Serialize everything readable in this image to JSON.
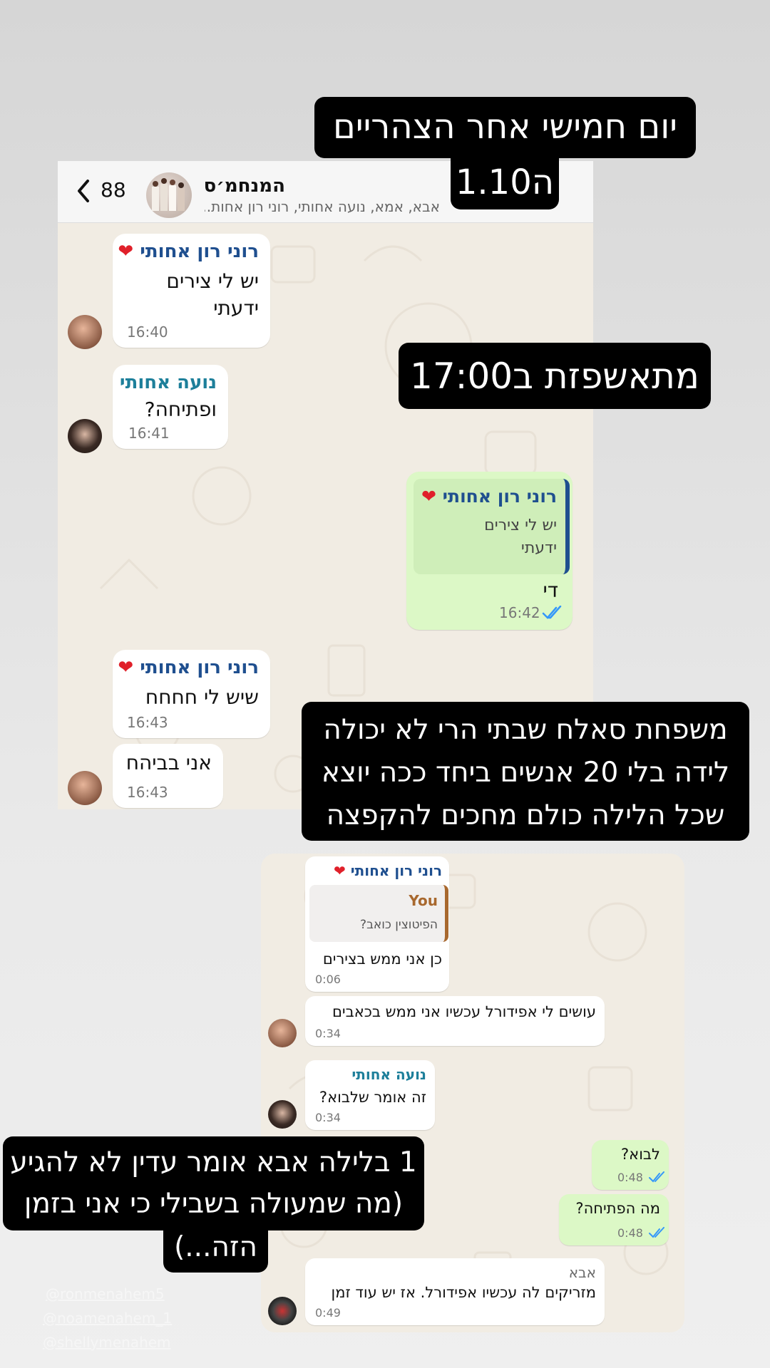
{
  "chat1": {
    "back_count": "88",
    "group_name": "המנחמ׳ס",
    "group_members": "אבא, אמא, נועה אחותי, רוני רון אחות...",
    "messages": [
      {
        "sender": "רוני רון אחותי",
        "emoji": "❤️",
        "lines": [
          "יש לי צירים",
          "ידעתי"
        ],
        "time": "16:40"
      },
      {
        "sender": "נועה אחותי",
        "lines": [
          "ופתיחה?"
        ],
        "time": "16:41"
      },
      {
        "quote_sender": "רוני רון אחותי",
        "quote_emoji": "❤️",
        "quote_lines": [
          "יש לי צירים",
          "ידעתי"
        ],
        "text": "די",
        "time": "16:42"
      },
      {
        "sender": "רוני רון אחותי",
        "emoji": "❤️",
        "lines": [
          "שיש לי חחחח"
        ],
        "time": "16:43"
      },
      {
        "text": "אני בביהח",
        "time": "16:43"
      }
    ]
  },
  "chat2": {
    "messages": [
      {
        "sender": "רוני רון אחותי",
        "emoji": "❤️",
        "quote_sender": "You",
        "quote_text": "הפיטוצין כואב?",
        "text": "כן אני ממש בצירים",
        "time": "0:06"
      },
      {
        "text": "עושים לי אפידורל עכשיו אני ממש בכאבים",
        "time": "0:34"
      },
      {
        "sender": "נועה אחותי",
        "text": "זה אומר שלבוא?",
        "time": "0:34"
      },
      {
        "text": "לבוא?",
        "time": "0:48"
      },
      {
        "text": "מה הפתיחה?",
        "time": "0:48"
      },
      {
        "sender": "אבא",
        "text": "מזריקים לה עכשיו אפידורל. אז יש עוד זמן",
        "time": "0:49"
      }
    ]
  },
  "captions": {
    "c1_line1": "יום חמישי אחר הצהריים",
    "c1_line2": "ה1.10",
    "c2": "מתאשפזת ב17:00",
    "c3_lines": [
      "משפחת סאלח שבתי הרי לא יכולה",
      "לידה בלי 20 אנשים ביחד ככה יוצא",
      "שכל הלילה כולם מחכים להקפצה"
    ],
    "c4_lines": [
      "1 בלילה אבא אומר עדין לא להגיע",
      "(מה שמעולה בשבילי כי אני בזמן",
      "הזה...)"
    ]
  },
  "handles": [
    "@ronmenahem5",
    "@noamenahem_1",
    "@shellymenahem"
  ],
  "colors": {
    "name_blue": "#1f4f8f",
    "noa_teal": "#1d7f9a",
    "you_brown": "#a8682e",
    "abba_gray": "#6b6b6b",
    "check_blue": "#3497f9",
    "out_bubble": "#dcf8c6"
  }
}
